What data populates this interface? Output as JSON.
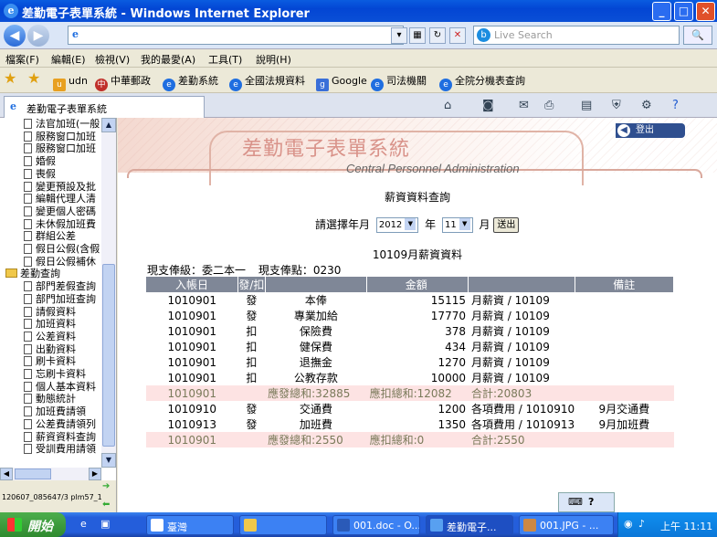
{
  "window": {
    "title": "差勤電子表單系統 - Windows Internet Explorer",
    "minimize": "_",
    "maximize": "□",
    "close": "✕"
  },
  "address": {
    "url": ""
  },
  "search": {
    "placeholder": "Live Search"
  },
  "menu": [
    "檔案(F)",
    "編輯(E)",
    "檢視(V)",
    "我的最愛(A)",
    "工具(T)",
    "說明(H)"
  ],
  "favorites": [
    {
      "label": "udn",
      "color": "#e8a020"
    },
    {
      "label": "中華郵政",
      "color": "#c0302a"
    },
    {
      "label": "差勤系統",
      "color": "#1f6ee0"
    },
    {
      "label": "全國法規資料",
      "color": "#1f6ee0"
    },
    {
      "label": "Google",
      "color": "#3a6fd8"
    },
    {
      "label": "司法機關",
      "color": "#1f6ee0"
    },
    {
      "label": "全院分機表查詢",
      "color": "#1f6ee0"
    }
  ],
  "tab": {
    "title": "差勤電子表單系統"
  },
  "sidebar": {
    "items": [
      {
        "label": "法官加班(一般",
        "folder": false
      },
      {
        "label": "服務窗口加班",
        "folder": false
      },
      {
        "label": "服務窗口加班",
        "folder": false
      },
      {
        "label": "婚假",
        "folder": false
      },
      {
        "label": "喪假",
        "folder": false
      },
      {
        "label": "變更預設及批",
        "folder": false
      },
      {
        "label": "編輯代理人清",
        "folder": false
      },
      {
        "label": "變更個人密碼",
        "folder": false
      },
      {
        "label": "未休假加班費",
        "folder": false
      },
      {
        "label": "群組公差",
        "folder": false
      },
      {
        "label": "假日公假(含假",
        "folder": false
      },
      {
        "label": "假日公假補休",
        "folder": false
      },
      {
        "label": "差勤查詢",
        "folder": true
      },
      {
        "label": "部門差假查詢",
        "folder": false
      },
      {
        "label": "部門加班查詢",
        "folder": false
      },
      {
        "label": "請假資料",
        "folder": false
      },
      {
        "label": "加班資料",
        "folder": false
      },
      {
        "label": "公差資料",
        "folder": false
      },
      {
        "label": "出勤資料",
        "folder": false
      },
      {
        "label": "刷卡資料",
        "folder": false
      },
      {
        "label": "忘刷卡資料",
        "folder": false
      },
      {
        "label": "個人基本資料",
        "folder": false
      },
      {
        "label": "動態統計",
        "folder": false
      },
      {
        "label": "加班費請領",
        "folder": false
      },
      {
        "label": "公差費請領列",
        "folder": false
      },
      {
        "label": "薪資資料查詢",
        "folder": false
      },
      {
        "label": "受訓費用請領",
        "folder": false
      }
    ],
    "status": "120607_085647/3 plm57_1"
  },
  "banner": {
    "title": "差勤電子表單系統",
    "subtitle": "Central Personnel Administration",
    "logout": "登出"
  },
  "page": {
    "title": "薪資資料查詢",
    "prompt": "請選擇年月",
    "year": "2012",
    "year_label": "年",
    "month": "11",
    "month_label": "月",
    "submit": "送出"
  },
  "report": {
    "title": "10109月薪資資料",
    "grade_label": "現支俸級：委二本一",
    "points_label": "現支俸點：0230",
    "headers": [
      "入帳日",
      "發/扣",
      "",
      "金額",
      "",
      "備註"
    ],
    "rows": [
      [
        "1010901",
        "發",
        "本俸",
        "15115",
        "月薪資 / 10109",
        ""
      ],
      [
        "1010901",
        "發",
        "專業加給",
        "17770",
        "月薪資 / 10109",
        ""
      ],
      [
        "1010901",
        "扣",
        "保險費",
        "378",
        "月薪資 / 10109",
        ""
      ],
      [
        "1010901",
        "扣",
        "健保費",
        "434",
        "月薪資 / 10109",
        ""
      ],
      [
        "1010901",
        "扣",
        "退撫金",
        "1270",
        "月薪資 / 10109",
        ""
      ],
      [
        "1010901",
        "扣",
        "公教存款",
        "10000",
        "月薪資 / 10109",
        ""
      ],
      [
        "1010901",
        "",
        "應發總和:32885",
        "應扣總和:12082",
        "合計:20803",
        ""
      ],
      [
        "1010910",
        "發",
        "交通費",
        "1200",
        "各項費用 / 1010910",
        "9月交通費"
      ],
      [
        "1010913",
        "發",
        "加班費",
        "1350",
        "各項費用 / 1010913",
        "9月加班費"
      ],
      [
        "1010901",
        "",
        "應發總和:2550",
        "應扣總和:0",
        "合計:2550",
        ""
      ]
    ],
    "sum_rows": [
      6,
      9
    ]
  },
  "taskbar": {
    "start": "開始",
    "items": [
      "臺灣",
      "",
      "001.doc - O...",
      "差勤電子...",
      "001.JPG - ..."
    ],
    "clock": "上午 11:11"
  }
}
